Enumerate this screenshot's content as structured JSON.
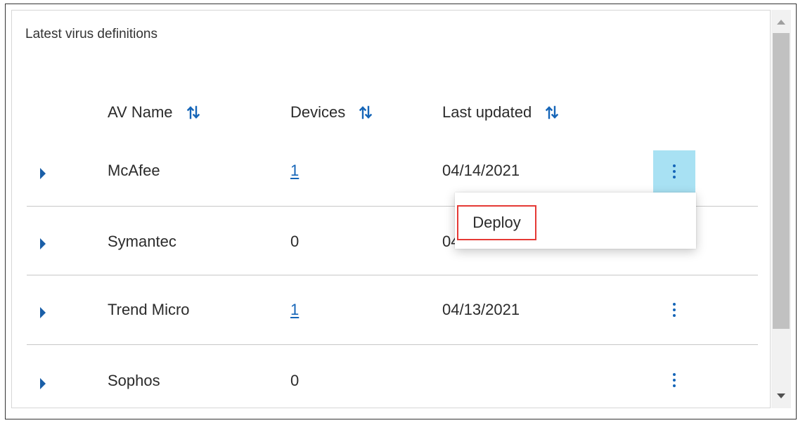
{
  "panel": {
    "title": "Latest virus definitions"
  },
  "columns": {
    "av_name": "AV Name",
    "devices": "Devices",
    "last_updated": "Last updated"
  },
  "rows": [
    {
      "name": "McAfee",
      "devices": "1",
      "devices_link": true,
      "last_updated": "04/14/2021",
      "menu_open": true
    },
    {
      "name": "Symantec",
      "devices": "0",
      "devices_link": false,
      "last_updated": "04/",
      "menu_open": false
    },
    {
      "name": "Trend Micro",
      "devices": "1",
      "devices_link": true,
      "last_updated": "04/13/2021",
      "menu_open": false
    },
    {
      "name": "Sophos",
      "devices": "0",
      "devices_link": false,
      "last_updated": "",
      "menu_open": false
    }
  ],
  "context_menu": {
    "items": [
      {
        "label": "Deploy"
      }
    ]
  },
  "icons": {
    "sort": "sort-arrows-icon",
    "expand": "caret-right-icon",
    "more": "kebab-menu-icon"
  },
  "colors": {
    "accent": "#1565b8",
    "active_button_bg": "#a8e1f3",
    "highlight_box": "#e53935"
  }
}
